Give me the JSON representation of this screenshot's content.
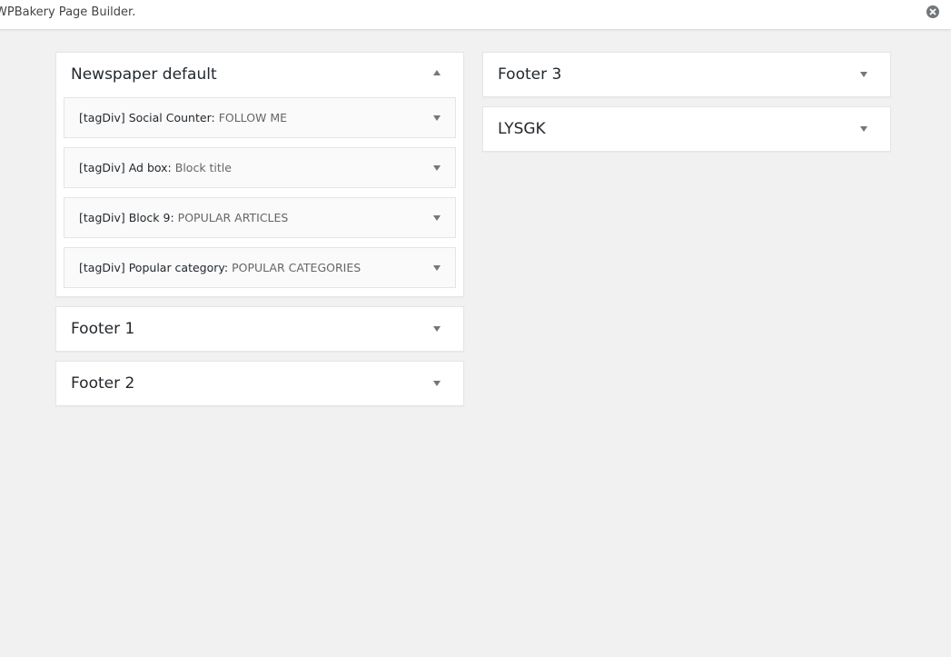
{
  "topbar": {
    "text": "WPBakery Page Builder.",
    "close_icon": "close-circle-icon"
  },
  "left_column": {
    "sidebars": [
      {
        "title": "Newspaper default",
        "expanded": true,
        "widgets": [
          {
            "name": "[tagDiv] Social Counter:",
            "title": "FOLLOW ME"
          },
          {
            "name": "[tagDiv] Ad box:",
            "title": "Block title"
          },
          {
            "name": "[tagDiv] Block 9:",
            "title": "POPULAR ARTICLES"
          },
          {
            "name": "[tagDiv] Popular category:",
            "title": "POPULAR CATEGORIES"
          }
        ]
      },
      {
        "title": "Footer 1",
        "expanded": false
      },
      {
        "title": "Footer 2",
        "expanded": false
      }
    ]
  },
  "right_column": {
    "sidebars": [
      {
        "title": "Footer 3",
        "expanded": false
      },
      {
        "title": "LYSGK",
        "expanded": false
      }
    ]
  },
  "colors": {
    "background": "#f1f1f1",
    "panel": "#ffffff",
    "widget": "#fafafa",
    "border": "#e5e5e5",
    "arrow": "#72777c"
  }
}
